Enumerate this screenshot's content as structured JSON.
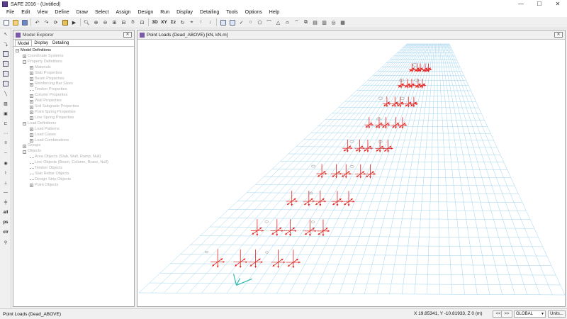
{
  "window": {
    "title": "SAFE 2016 - (Untitled)",
    "minimize": "—",
    "maximize": "☐",
    "close": "✕"
  },
  "menu": [
    "File",
    "Edit",
    "View",
    "Define",
    "Draw",
    "Select",
    "Assign",
    "Design",
    "Run",
    "Display",
    "Detailing",
    "Tools",
    "Options",
    "Help"
  ],
  "toolbar": {
    "view_3d": "3D",
    "view_xy": "XY",
    "view_xz": "Σz"
  },
  "left_toolbar": {
    "all": "all",
    "ps": "ps",
    "clr": "clr"
  },
  "explorer": {
    "title": "Model Explorer",
    "close": "✕",
    "tabs": [
      "Model",
      "Display",
      "Detailing"
    ],
    "tree": [
      {
        "label": "Model Definitions",
        "level": 0,
        "box": "−",
        "root": true
      },
      {
        "label": "Coordinate Systems",
        "level": 1,
        "box": "+"
      },
      {
        "label": "Property Definitions",
        "level": 1,
        "box": "−"
      },
      {
        "label": "Materials",
        "level": 2,
        "box": "+"
      },
      {
        "label": "Slab Properties",
        "level": 2,
        "box": "+"
      },
      {
        "label": "Beam Properties",
        "level": 2,
        "box": "+"
      },
      {
        "label": "Reinforcing Bar Sizes",
        "level": 2,
        "box": "+"
      },
      {
        "label": "Tendon Properties",
        "level": 2,
        "box": ""
      },
      {
        "label": "Column Properties",
        "level": 2,
        "box": "+"
      },
      {
        "label": "Wall Properties",
        "level": 2,
        "box": "+"
      },
      {
        "label": "Soil Subgrade Properties",
        "level": 2,
        "box": "+"
      },
      {
        "label": "Point Spring Properties",
        "level": 2,
        "box": "+"
      },
      {
        "label": "Line Spring Properties",
        "level": 2,
        "box": "+"
      },
      {
        "label": "Load Definitions",
        "level": 1,
        "box": "−"
      },
      {
        "label": "Load Patterns",
        "level": 2,
        "box": "+"
      },
      {
        "label": "Load Cases",
        "level": 2,
        "box": "+"
      },
      {
        "label": "Load Combinations",
        "level": 2,
        "box": "+"
      },
      {
        "label": "Groups",
        "level": 1,
        "box": "+"
      },
      {
        "label": "Objects",
        "level": 1,
        "box": "−"
      },
      {
        "label": "Area Objects (Slab, Wall, Ramp, Null)",
        "level": 2,
        "box": ""
      },
      {
        "label": "Line Objects (Beam, Column, Brace, Null)",
        "level": 2,
        "box": ""
      },
      {
        "label": "Tendon Objects",
        "level": 2,
        "box": ""
      },
      {
        "label": "Slab Rebar Objects",
        "level": 2,
        "box": ""
      },
      {
        "label": "Design Strip Objects",
        "level": 2,
        "box": ""
      },
      {
        "label": "Point Objects",
        "level": 2,
        "box": "+"
      }
    ]
  },
  "viewport": {
    "title": "Point Loads (Dead_ABOVE)  [kN, kN-m]",
    "close": "✕"
  },
  "status": {
    "left": "Point Loads (Dead_ABOVE)",
    "coords": "X 19.85341,  Y -10.81933,  Z 0   (m)",
    "nav_prev": "<<",
    "nav_next": ">>",
    "coord_system": "GLOBAL",
    "units": "Units..."
  },
  "colors": {
    "grid": "#9fd3ee",
    "load_arrows": "#e8201c",
    "axis": "#2fb8a8"
  }
}
